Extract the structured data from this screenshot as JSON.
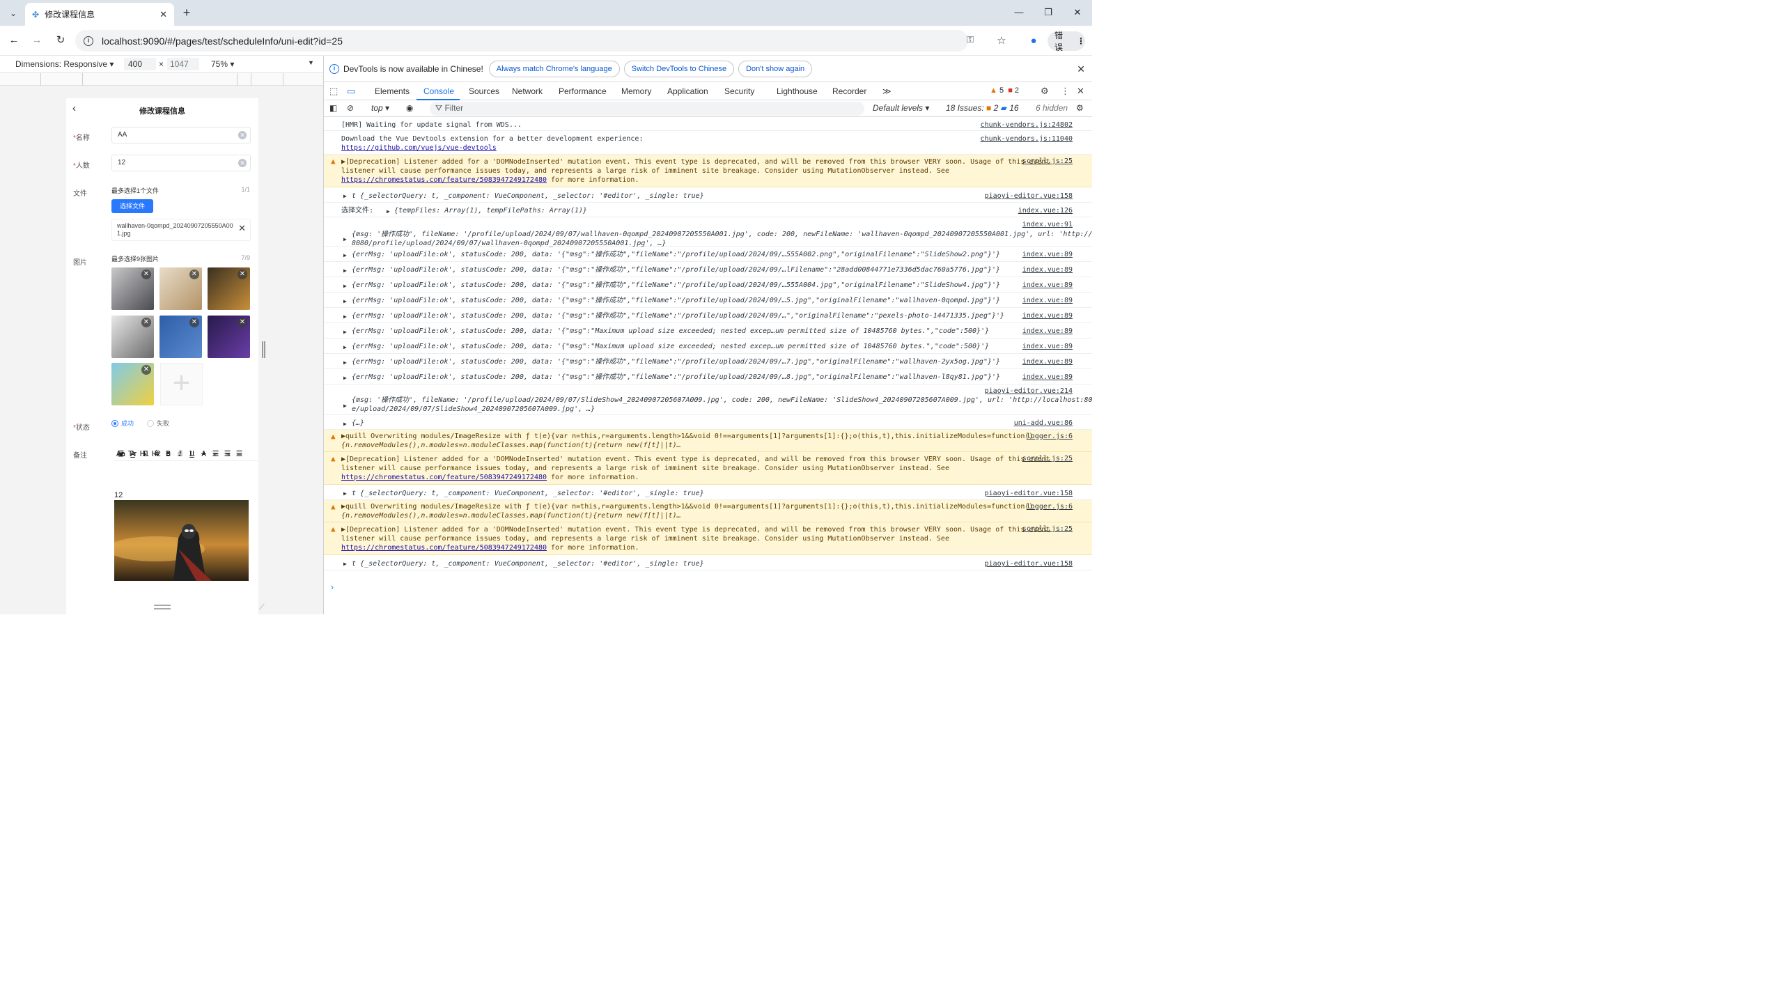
{
  "browser": {
    "tab_title": "修改课程信息",
    "url": "localhost:9090/#/pages/test/scheduleInfo/uni-edit?id=25",
    "error_button_label": "错误"
  },
  "device_toolbar": {
    "dimensions_label": "Dimensions: Responsive",
    "width_value": "400",
    "height_value": "1047",
    "times": "×",
    "zoom": "75%"
  },
  "app": {
    "page_title": "修改课程信息",
    "name_label": "名称",
    "name_value": "AA",
    "people_label": "人数",
    "people_value": "12",
    "required_mark": "*",
    "file_label": "文件",
    "file_hint": "最多选择1个文件",
    "file_count": "1/1",
    "choose_file_button": "选择文件",
    "file_name": "wallhaven-0qompd_20240907205550A001.jpg",
    "image_label": "图片",
    "image_hint": "最多选择9张图片",
    "image_count": "7/9",
    "status_label": "状态",
    "status_options": [
      "成功",
      "失败"
    ],
    "status_selected": "成功",
    "note_label": "备注",
    "editor_text": "12",
    "images": [
      {
        "name": "anime-figure",
        "colors": [
          "#c9c9c9",
          "#4a4a52"
        ]
      },
      {
        "name": "puppies",
        "colors": [
          "#e8dcc8",
          "#b39366"
        ]
      },
      {
        "name": "armored-hero-sunset",
        "colors": [
          "#3a3020",
          "#c98f3a"
        ]
      },
      {
        "name": "cartoon-creature",
        "colors": [
          "#e8e8e8",
          "#6a6a6a"
        ]
      },
      {
        "name": "birds-blue-sky",
        "colors": [
          "#2d5fa8",
          "#5c8ad0"
        ]
      },
      {
        "name": "neon-room",
        "colors": [
          "#281a4a",
          "#6a3ea8"
        ]
      },
      {
        "name": "spongebob-patrick",
        "colors": [
          "#7ecbe8",
          "#f0d040"
        ]
      }
    ]
  },
  "devtools": {
    "infobar_text": "DevTools is now available in Chinese!",
    "infobar_buttons": [
      "Always match Chrome's language",
      "Switch DevTools to Chinese",
      "Don't show again"
    ],
    "tabs": [
      "Elements",
      "Console",
      "Sources",
      "Network",
      "Performance",
      "Memory",
      "Application",
      "Security",
      "Lighthouse",
      "Recorder"
    ],
    "active_tab": "Console",
    "more_tabs": "≫",
    "warn_count": "5",
    "error_count": "2",
    "context": "top",
    "filter_placeholder": "Filter",
    "levels": "Default levels",
    "issues_label": "18 Issues:",
    "issues_errors": "2",
    "issues_info": "16",
    "hidden": "6 hidden"
  },
  "console": {
    "hmr": "[HMR] Waiting for update signal from WDS...",
    "hmr_src": "chunk-vendors.js:24802",
    "vue_dl_1": "Download the Vue Devtools extension for a better development experience:",
    "vue_dl_link": "https://github.com/vuejs/vue-devtools",
    "vue_dl_src": "chunk-vendors.js:11040",
    "dep_1": "▶[Deprecation] Listener added for a 'DOMNodeInserted' mutation event. This event type is deprecated, and will be removed from this browser VERY soon. Usage of this event",
    "dep_2": "listener will cause performance issues today, and represents a large risk of imminent site breakage. Consider using MutationObserver instead. See",
    "dep_link": "https://chromestatus.com/feature/5083947249172480",
    "dep_3": " for more information.",
    "scroll_src": "scroll.js:25",
    "t_obj": "t {_selectorQuery: t, _component: VueComponent, _selector: '#editor', _single: true}",
    "piaoyi_src": "piaoyi-editor.vue:158",
    "select_file": "选择文件:",
    "select_file_obj": "{tempFiles: Array(1), tempFilePaths: Array(1)}",
    "idx126": "index.vue:126",
    "idx91": "index.vue:91",
    "msg1_a": "{msg: '操作成功', fileName: '/profile/upload/2024/09/07/wallhaven-0qompd_20240907205550A001.jpg', code: 200, newFileName: 'wallhaven-0qompd_20240907205550A001.jpg', url: 'http://localhost:",
    "msg1_b": "8080/profile/upload/2024/09/07/wallhaven-0qompd_20240907205550A001.jpg', …}",
    "up_rows": [
      "{errMsg: 'uploadFile:ok', statusCode: 200, data: '{\"msg\":\"操作成功\",\"fileName\":\"/profile/upload/2024/09/…555A002.png\",\"originalFilename\":\"SlideShow2.png\"}'}",
      "{errMsg: 'uploadFile:ok', statusCode: 200, data: '{\"msg\":\"操作成功\",\"fileName\":\"/profile/upload/2024/09/…lFilename\":\"28add00844771e7336d5dac760a5776.jpg\"}'}",
      "{errMsg: 'uploadFile:ok', statusCode: 200, data: '{\"msg\":\"操作成功\",\"fileName\":\"/profile/upload/2024/09/…555A004.jpg\",\"originalFilename\":\"SlideShow4.jpg\"}'}",
      "{errMsg: 'uploadFile:ok', statusCode: 200, data: '{\"msg\":\"操作成功\",\"fileName\":\"/profile/upload/2024/09/…5.jpg\",\"originalFilename\":\"wallhaven-0qompd.jpg\"}'}",
      "{errMsg: 'uploadFile:ok', statusCode: 200, data: '{\"msg\":\"操作成功\",\"fileName\":\"/profile/upload/2024/09/…\",\"originalFilename\":\"pexels-photo-14471335.jpeg\"}'}",
      "{errMsg: 'uploadFile:ok', statusCode: 200, data: '{\"msg\":\"Maximum upload size exceeded; nested excep…um permitted size of 10485760 bytes.\",\"code\":500}'}",
      "{errMsg: 'uploadFile:ok', statusCode: 200, data: '{\"msg\":\"Maximum upload size exceeded; nested excep…um permitted size of 10485760 bytes.\",\"code\":500}'}",
      "{errMsg: 'uploadFile:ok', statusCode: 200, data: '{\"msg\":\"操作成功\",\"fileName\":\"/profile/upload/2024/09/…7.jpg\",\"originalFilename\":\"wallhaven-2yx5og.jpg\"}'}",
      "{errMsg: 'uploadFile:ok', statusCode: 200, data: '{\"msg\":\"操作成功\",\"fileName\":\"/profile/upload/2024/09/…8.jpg\",\"originalFilename\":\"wallhaven-l8qy81.jpg\"}'}"
    ],
    "idx89": "index.vue:89",
    "piaoyi214": "piaoyi-editor.vue:214",
    "msg2_a": "{msg: '操作成功', fileName: '/profile/upload/2024/09/07/SlideShow4_20240907205607A009.jpg', code: 200, newFileName: 'SlideShow4_20240907205607A009.jpg', url: 'http://localhost:8080/profil",
    "msg2_b": "e/upload/2024/09/07/SlideShow4_20240907205607A009.jpg', …}",
    "uniadd": "{…}",
    "uniadd_src": "uni-add.vue:86",
    "quill_1": "▶quill Overwriting modules/ImageResize with ƒ t(e){var n=this,r=arguments.length>1&&void 0!==arguments[1]?arguments[1]:{};o(this,t),this.initializeModules=function()",
    "quill_2": "{n.removeModules(),n.modules=n.moduleClasses.map(function(t){return new(f[t]||t)…",
    "logger_src": "logger.js:6",
    "prompt": "›"
  }
}
